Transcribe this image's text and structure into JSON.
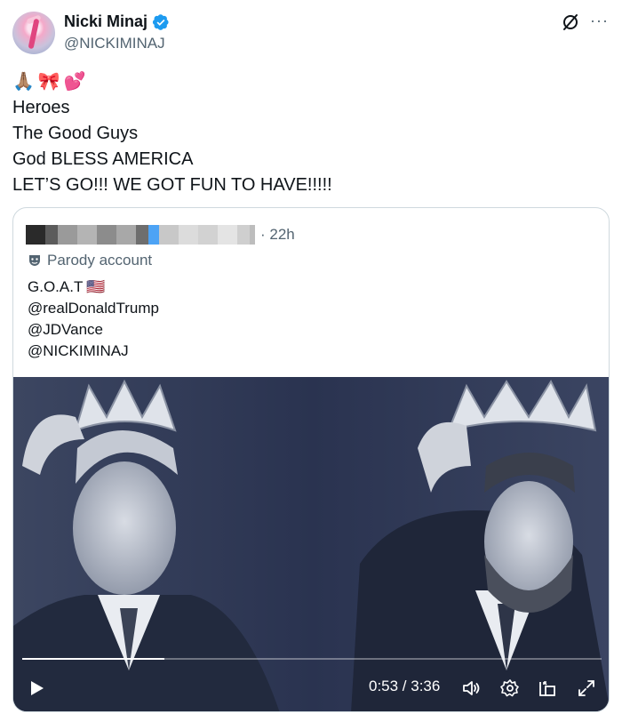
{
  "author": {
    "name": "Nicki Minaj",
    "handle": "@NICKIMINAJ",
    "verified_color": "#1d9bf0"
  },
  "header_icons": [
    "grok-icon",
    "more-icon"
  ],
  "more_label": "···",
  "tweet": {
    "emojis": [
      "🙏🏽",
      "🎀",
      "💕"
    ],
    "lines": [
      "Heroes",
      "The Good Guys",
      "God BLESS AMERICA",
      "LET’S GO!!! WE GOT FUN TO HAVE!!!!!"
    ]
  },
  "quote": {
    "time": "· 22h",
    "label": "Parody account",
    "lines": [
      "G.O.A.T",
      "@realDonaldTrump",
      "@JDVance",
      "@NICKIMINAJ"
    ],
    "flag_emoji": "🇺🇸"
  },
  "video": {
    "current_time": "0:53",
    "duration": "3:36",
    "time_display": "0:53 / 3:36",
    "progress_fraction": 0.245,
    "controls": [
      "play-icon",
      "volume-icon",
      "settings-icon",
      "pip-icon",
      "fullscreen-icon"
    ]
  }
}
